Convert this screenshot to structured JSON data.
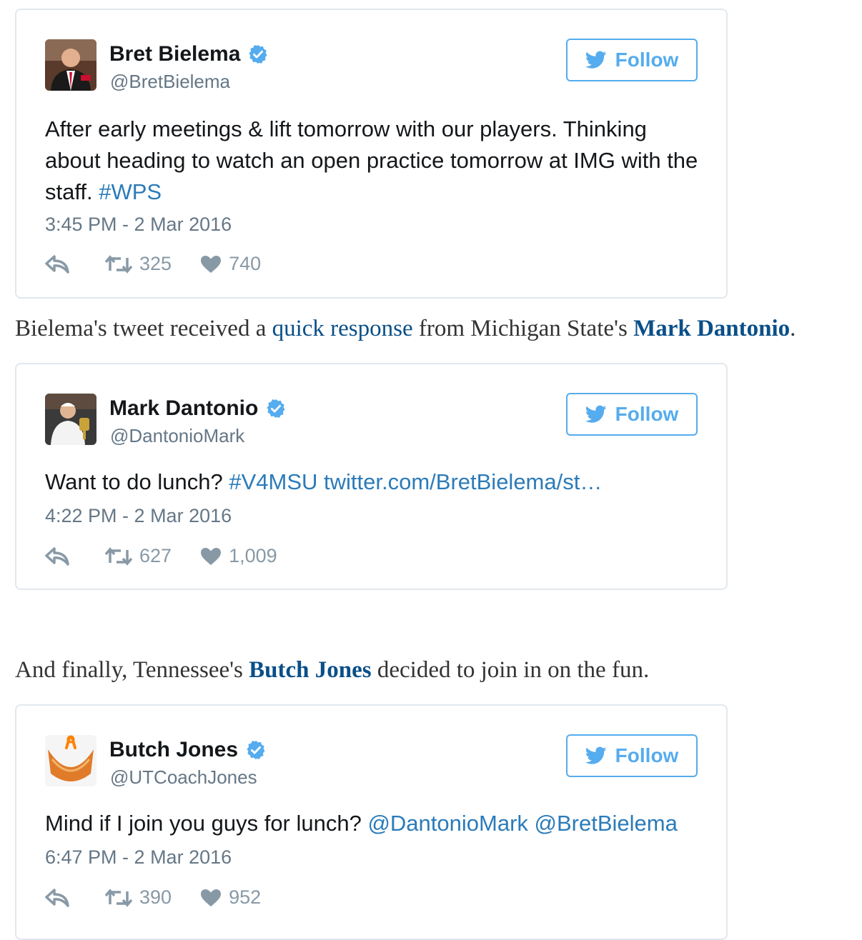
{
  "tweets": [
    {
      "name": "Bret Bielema",
      "handle": "@BretBielema",
      "follow_label": "Follow",
      "text_before": "After early meetings & lift tomorrow with our players. Thinking about heading to watch an open practice tomorrow at IMG with the staff. ",
      "hashtag": "#WPS",
      "timestamp": "3:45 PM - 2 Mar 2016",
      "retweets": "325",
      "likes": "740"
    },
    {
      "name": "Mark Dantonio",
      "handle": "@DantonioMark",
      "follow_label": "Follow",
      "text_before": "Want to do lunch? ",
      "hashtag": "#V4MSU",
      "link": "twitter.com/BretBielema/st…",
      "timestamp": "4:22 PM - 2 Mar 2016",
      "retweets": "627",
      "likes": "1,009"
    },
    {
      "name": "Butch Jones",
      "handle": "@UTCoachJones",
      "follow_label": "Follow",
      "text_before": "Mind if I join you guys for lunch? ",
      "mention1": "@DantonioMark",
      "mention2": "@BretBielema",
      "timestamp": "6:47 PM - 2 Mar 2016",
      "retweets": "390",
      "likes": "952"
    }
  ],
  "prose1": {
    "before": "Bielema's tweet received a ",
    "link": "quick response",
    "middle": " from Michigan State's ",
    "bold": "Mark Dantonio",
    "after": "."
  },
  "prose2": {
    "before": "And finally, Tennessee's ",
    "bold": "Butch Jones",
    "after": " decided to join in on the fun."
  },
  "colors": {
    "twitter_blue": "#55acee",
    "link_blue": "#2b7bb9",
    "prose_link": "#0a4f88",
    "muted": "#657786"
  }
}
